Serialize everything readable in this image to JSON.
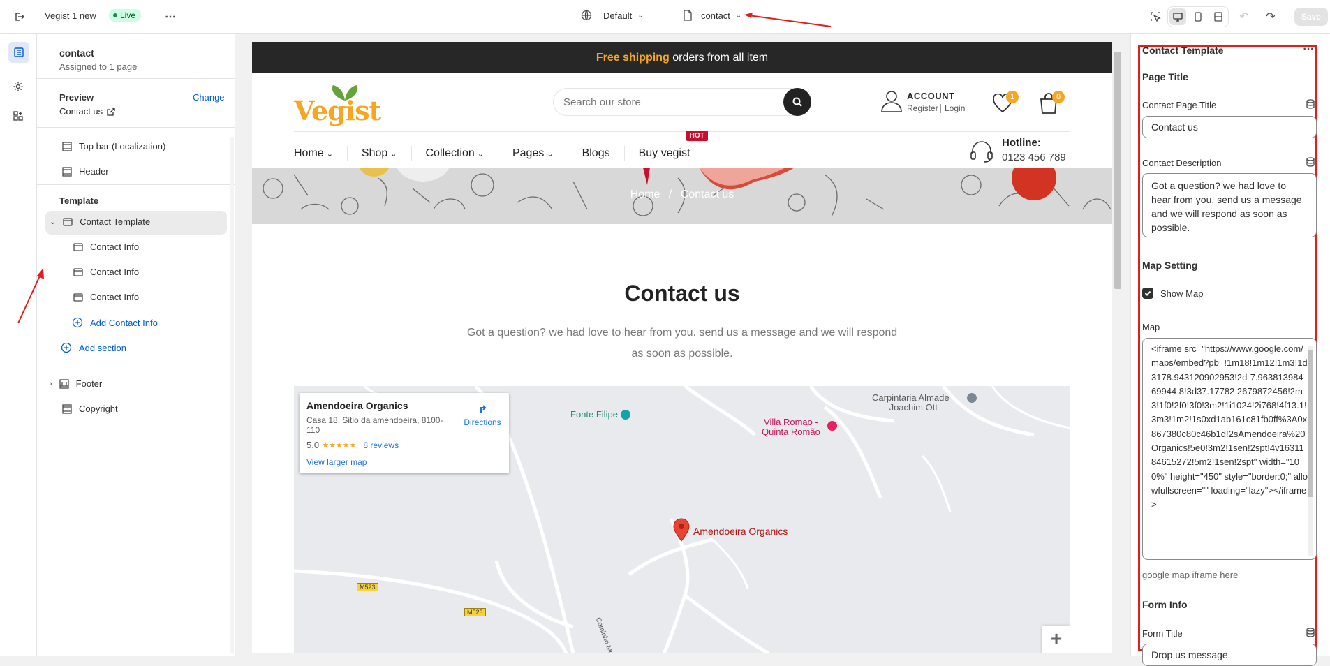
{
  "topbar": {
    "store_name": "Vegist 1 new",
    "live_badge": "Live",
    "theme_selector": "Default",
    "page_selector": "contact",
    "save_label": "Save"
  },
  "sidebar": {
    "page_title": "contact",
    "assigned": "Assigned to 1 page",
    "preview_label": "Preview",
    "preview_change": "Change",
    "preview_page": "Contact us",
    "header_items": [
      "Top bar (Localization)",
      "Header"
    ],
    "template_heading": "Template",
    "template_name": "Contact Template",
    "blocks": [
      "Contact Info",
      "Contact Info",
      "Contact Info"
    ],
    "add_block": "Add Contact Info",
    "add_section": "Add section",
    "footer_items": [
      "Footer",
      "Copyright"
    ]
  },
  "store": {
    "announcement_highlight": "Free shipping",
    "announcement_rest": " orders from all item",
    "logo": "Vegist",
    "search_placeholder": "Search our store",
    "account_label": "ACCOUNT",
    "register": "Register",
    "login": "Login",
    "wishlist_count": "1",
    "cart_count": "0",
    "nav": [
      "Home",
      "Shop",
      "Collection",
      "Pages",
      "Blogs",
      "Buy vegist"
    ],
    "hot_badge": "HOT",
    "hotline_label": "Hotline:",
    "hotline_number": "0123 456 789",
    "breadcrumb_home": "Home",
    "breadcrumb_sep": "/",
    "breadcrumb_current": "Contact us",
    "page_heading": "Contact us",
    "page_desc_line1": "Got a question? we had love to hear from you. send us a message and we will respond",
    "page_desc_line2": "as soon as possible."
  },
  "map": {
    "card_title": "Amendoeira Organics",
    "card_address": "Casa 18, Sitio da amendoeira, 8100-110",
    "rating": "5.0",
    "stars": "★★★★★",
    "reviews": "8 reviews",
    "larger_map": "View larger map",
    "directions": "Directions",
    "place_fonte": "Fonte Filipe",
    "place_villa_line1": "Villa Romao -",
    "place_villa_line2": "Quinta Romão",
    "place_carpintaria_line1": "Carpintaria Almade",
    "place_carpintaria_line2": "- Joachim Ott",
    "pin_label": "Amendoeira Organics",
    "road_1": "M523",
    "road_2": "M523",
    "road_3": "Caminho Moinho d",
    "zoom_in": "+"
  },
  "settings": {
    "panel_title": "Contact Template",
    "page_title_heading": "Page Title",
    "contact_page_title_label": "Contact Page Title",
    "contact_page_title_value": "Contact us",
    "contact_desc_label": "Contact Description",
    "contact_desc_value": "Got a question? we had love to hear from you. send us a message and we will respond as soon as possible.",
    "map_setting_heading": "Map Setting",
    "show_map_label": "Show Map",
    "map_label": "Map",
    "map_value": "<iframe src=\"https://www.google.com/maps/embed?pb=!1m18!1m12!1m3!1d3178.943120902953!2d-7.96381398469944 8!3d37.17782 2679872456!2m3!1f0!2f0!3f0!3m2!1i1024!2i768!4f13.1!3m3!1m2!1s0xd1ab161c81fb0ff%3A0x867380c80c46b1d!2sAmendoeira%20Organics!5e0!3m2!1sen!2spt!4v1631184615272!5m2!1sen!2spt\" width=\"100%\" height=\"450\" style=\"border:0;\" allowfullscreen=\"\" loading=\"lazy\"></iframe>",
    "map_help": "google map iframe here",
    "form_info_heading": "Form Info",
    "form_title_label": "Form Title",
    "form_title_value": "Drop us message"
  },
  "colors": {
    "accent_orange": "#f5a623",
    "leaf_green": "#62a33a",
    "highlight_red": "#e01e1e",
    "link_blue": "#005bd3"
  }
}
